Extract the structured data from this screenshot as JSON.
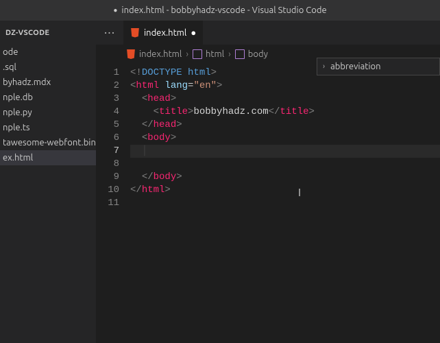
{
  "title": "index.html - bobbyhadz-vscode - Visual Studio Code",
  "title_dirty_dot": "●",
  "sidebar": {
    "header": "DZ-VSCODE",
    "items": [
      "ode",
      ".sql",
      "byhadz.mdx",
      "nple.db",
      "nple.py",
      "nple.ts",
      "tawesome-webfont.bin",
      "ex.html"
    ],
    "selected_index": 7
  },
  "tab": {
    "label": "index.html",
    "dirty": "●"
  },
  "overflow": "···",
  "breadcrumbs": [
    {
      "label": "index.html",
      "icon": "html5"
    },
    {
      "label": "html",
      "icon": "sym"
    },
    {
      "label": "body",
      "icon": "sym"
    }
  ],
  "breadcrumb_sep": "›",
  "suggest": {
    "chevron": "›",
    "label": "abbreviation"
  },
  "code": {
    "lines": [
      "1",
      "2",
      "3",
      "4",
      "5",
      "6",
      "7",
      "8",
      "9",
      "10",
      "11"
    ],
    "active_line_index": 6,
    "l1_doctype": "DOCTYPE",
    "l1_html": "html",
    "l2_tag": "html",
    "l2_attr": "lang",
    "l2_val": "\"en\"",
    "l3_tag": "head",
    "l4_tag_open": "title",
    "l4_text": "bobbyhadz.com",
    "l4_tag_close": "title",
    "l5_tag": "head",
    "l6_tag": "body",
    "l9_tag": "body",
    "l10_tag": "html"
  }
}
